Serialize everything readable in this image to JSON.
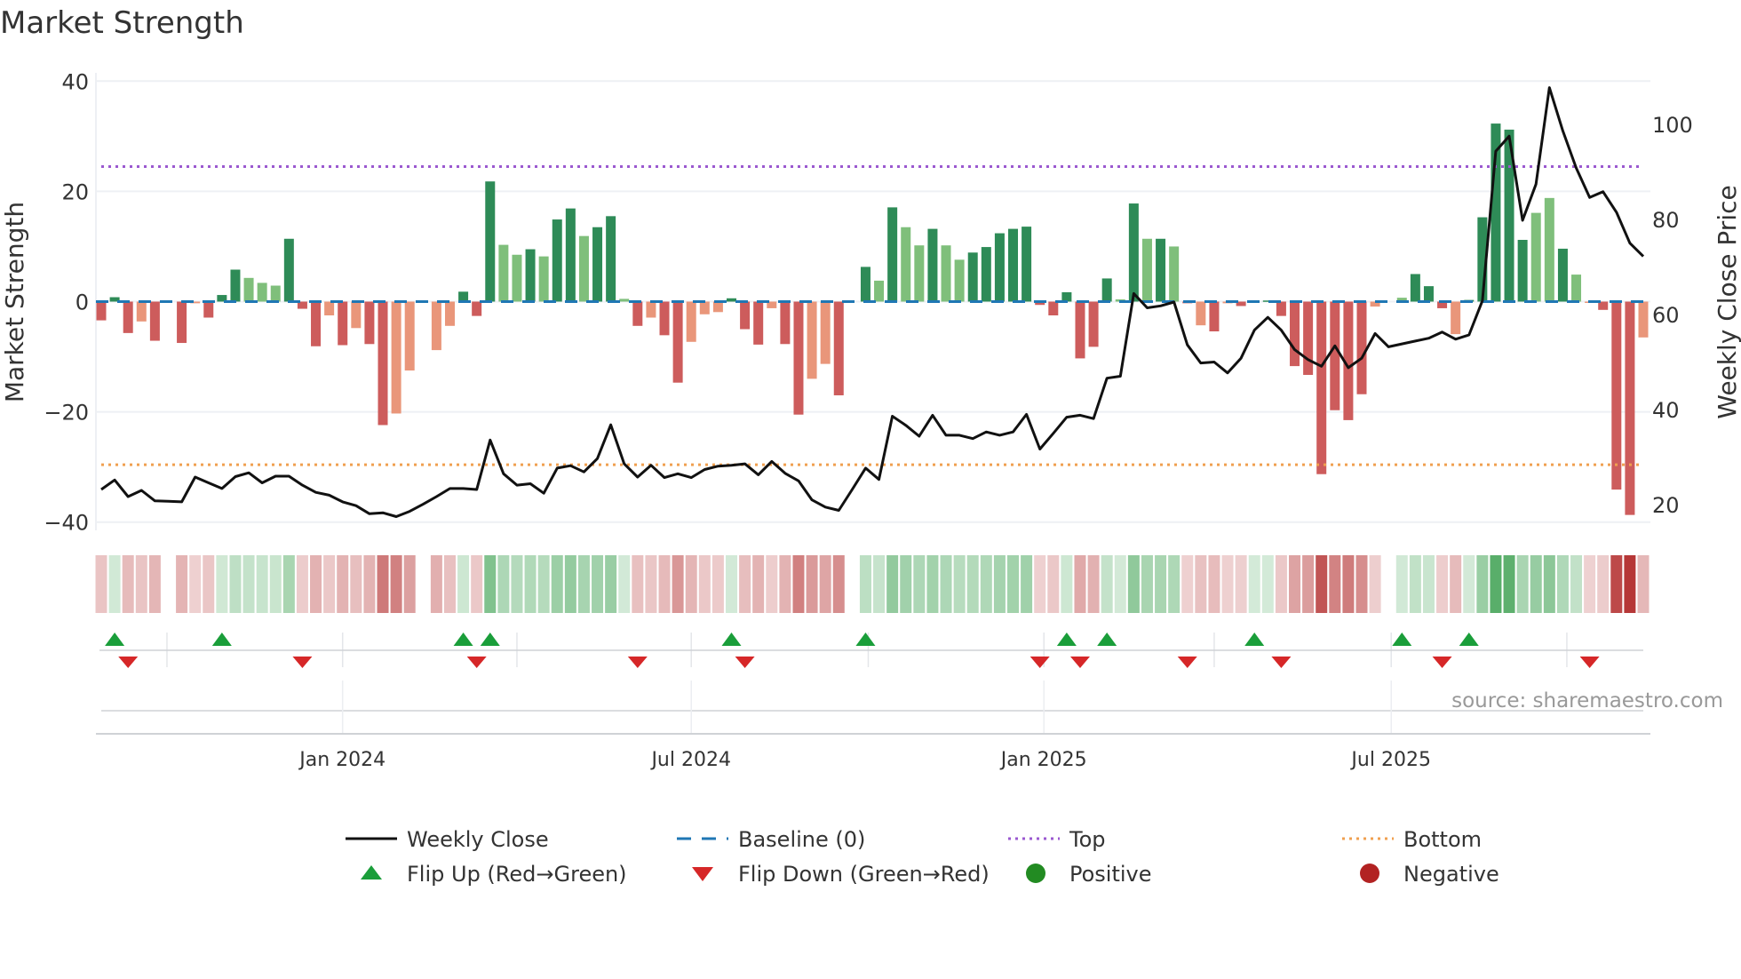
{
  "title": "Market Strength",
  "source": "source: sharemaestro.com",
  "colors": {
    "pos_dark": "#2e8b57",
    "pos_light": "#7fbf7b",
    "neg_dark": "#cd5c5c",
    "neg_light": "#e9967a",
    "line": "#111111",
    "baseline": "#1f77b4",
    "top": "#9b59d0",
    "bottom": "#f0a050",
    "flip_up": "#1a9e3a",
    "flip_down": "#d62728",
    "positive": "#228b22",
    "negative": "#b22222"
  },
  "legend": [
    {
      "label": "Weekly Close",
      "icon": "line"
    },
    {
      "label": "Baseline (0)",
      "icon": "dash"
    },
    {
      "label": "Top",
      "icon": "dot-purple"
    },
    {
      "label": "Bottom",
      "icon": "dot-orange"
    },
    {
      "label": "Flip Up (Red→Green)",
      "icon": "triangle-up"
    },
    {
      "label": "Flip Down (Green→Red)",
      "icon": "triangle-down"
    },
    {
      "label": "Positive",
      "icon": "circle-green"
    },
    {
      "label": "Negative",
      "icon": "circle-red"
    }
  ],
  "chart_data": {
    "type": "bar",
    "title": "Market Strength",
    "ylabel": "Market Strength",
    "y2label": "Weekly Close Price",
    "ylim": [
      -41.5,
      41.5
    ],
    "y2lim": [
      14.6,
      110.8
    ],
    "yticks": [
      40,
      20,
      0,
      -20,
      -40
    ],
    "ytick_labels": [
      "40",
      "20",
      "0",
      "−20",
      "−40"
    ],
    "y2ticks": [
      100,
      80,
      60,
      40,
      20
    ],
    "y2tick_labels": [
      "100",
      "80",
      "60",
      "40",
      "20"
    ],
    "top_level": 24.5,
    "bottom_level": -29.6,
    "baseline": 0,
    "x_ticks": [
      {
        "week": 18,
        "label": "Jan 2024"
      },
      {
        "week": 44,
        "label": "Jul 2024"
      },
      {
        "week": 70.3,
        "label": "Jan 2025"
      },
      {
        "week": 96.2,
        "label": "Jul 2025"
      }
    ],
    "quarter_grid_weeks": [
      4.9,
      18,
      31,
      44,
      57.2,
      70.3,
      83,
      96.2,
      109.3
    ],
    "strength": [
      -3.4,
      0.8,
      -5.7,
      -3.6,
      -7.1,
      0,
      -7.5,
      -0.3,
      -2.9,
      1.2,
      5.8,
      4.3,
      3.4,
      2.9,
      11.4,
      -1.3,
      -8.1,
      -2.5,
      -7.9,
      -4.8,
      -7.7,
      -22.4,
      -20.3,
      -12.5,
      0,
      -8.8,
      -4.4,
      1.8,
      -2.6,
      21.8,
      10.3,
      8.5,
      9.5,
      8.2,
      14.9,
      16.9,
      11.9,
      13.5,
      15.5,
      0.5,
      -4.4,
      -2.9,
      -6.1,
      -14.7,
      -7.3,
      -2.3,
      -1.9,
      0.6,
      -5,
      -7.8,
      -1.2,
      -7.7,
      -20.5,
      -14,
      -11.3,
      -17,
      0,
      6.3,
      3.8,
      17.1,
      13.5,
      10.2,
      13.2,
      10.2,
      7.6,
      8.9,
      9.9,
      12.4,
      13.2,
      13.6,
      -0.6,
      -2.5,
      1.7,
      -10.3,
      -8.2,
      4.2,
      0.4,
      17.8,
      11.4,
      11.4,
      10,
      -0.3,
      -4.3,
      -5.4,
      -0.3,
      -0.8,
      0.1,
      0.2,
      -2.6,
      -11.7,
      -13.3,
      -31.3,
      -19.7,
      -21.5,
      -16.8,
      -0.9,
      0,
      0.7,
      5,
      2.8,
      -1.2,
      -5.9,
      0.3,
      15.3,
      32.3,
      31.2,
      11.2,
      16.1,
      18.8,
      9.6,
      4.9,
      -0.2,
      -1.5,
      -34.1,
      -38.7,
      -6.5
    ],
    "shade": "ddddld dldddllldddldldddlldlldlllddlldldlddlldldlllddldddllldl",
    "light_indices": [
      3,
      7,
      11,
      12,
      13,
      17,
      19,
      22,
      23,
      25,
      26,
      30,
      31,
      33,
      36,
      39,
      41,
      44,
      45,
      46,
      50,
      53,
      54,
      58,
      60,
      61,
      63,
      64,
      76,
      78,
      80,
      82,
      84,
      95,
      97,
      101,
      107,
      108,
      110,
      111,
      115
    ],
    "weekly_close": [
      23.2,
      25.2,
      21.7,
      23.0,
      20.8,
      20.7,
      20.6,
      25.8,
      24.6,
      23.4,
      25.9,
      26.7,
      24.6,
      26.0,
      26.0,
      24.1,
      22.6,
      22.0,
      20.6,
      19.8,
      18.1,
      18.3,
      17.5,
      18.6,
      20.1,
      21.7,
      23.4,
      23.4,
      23.2,
      33.6,
      26.5,
      24.1,
      24.4,
      22.4,
      27.7,
      28.2,
      26.9,
      29.7,
      36.8,
      28.6,
      25.8,
      28.3,
      25.7,
      26.5,
      25.7,
      27.4,
      28.1,
      28.3,
      28.6,
      26.3,
      29.1,
      26.6,
      25.0,
      21.0,
      19.5,
      18.8,
      23.2,
      27.7,
      25.3,
      38.6,
      36.7,
      34.4,
      38.8,
      34.6,
      34.6,
      33.9,
      35.3,
      34.6,
      35.3,
      39.0,
      31.7,
      35.0,
      38.4,
      38.8,
      38.1,
      46.6,
      47.0,
      64.4,
      61.4,
      61.8,
      62.6,
      53.6,
      49.8,
      50.0,
      47.7,
      50.8,
      56.7,
      59.4,
      56.7,
      52.6,
      50.5,
      49.1,
      53.4,
      48.8,
      50.8,
      56.0,
      53.2,
      53.8,
      54.4,
      55.0,
      56.3,
      54.8,
      55.7,
      62.9,
      94.3,
      97.5,
      79.8,
      87.4,
      107.7,
      98.6,
      90.8,
      84.6,
      85.8,
      81.5,
      75.0,
      72.2
    ],
    "flip_up_weeks": [
      1,
      9,
      27,
      29,
      47,
      57,
      72,
      75,
      86,
      97,
      102
    ],
    "flip_down_weeks": [
      2,
      15,
      28,
      40,
      48,
      70,
      73,
      81,
      88,
      100,
      111
    ]
  }
}
